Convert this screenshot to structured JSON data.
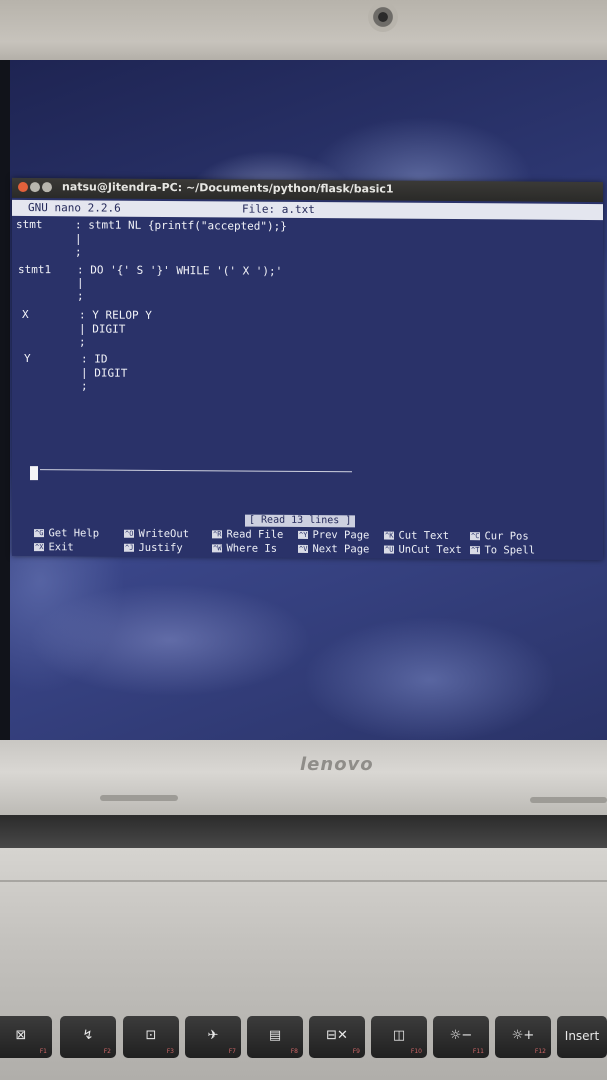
{
  "brand": "lenovo",
  "window": {
    "title": "natsu@Jitendra-PC: ~/Documents/python/flask/basic1"
  },
  "nano": {
    "version": "GNU nano 2.2.6",
    "file": "File: a.txt",
    "status": "[ Read 13 lines ]",
    "lines": [
      {
        "label": "stmt",
        "code": ": stmt1 NL {printf(\"accepted\");}"
      },
      {
        "label": "",
        "code": "|"
      },
      {
        "label": "",
        "code": ";"
      },
      {
        "label": "stmt1",
        "code": ": DO '{' S '}' WHILE '(' X ');'"
      },
      {
        "label": "",
        "code": "|"
      },
      {
        "label": "",
        "code": ";"
      },
      {
        "label": "X",
        "code": ": Y RELOP Y"
      },
      {
        "label": "",
        "code": "| DIGIT"
      },
      {
        "label": "",
        "code": ";"
      },
      {
        "label": "Y",
        "code": ": ID"
      },
      {
        "label": "",
        "code": "| DIGIT"
      },
      {
        "label": "",
        "code": ";"
      }
    ],
    "shortcuts_row1": [
      {
        "key": "^G",
        "label": "Get Help"
      },
      {
        "key": "^O",
        "label": "WriteOut"
      },
      {
        "key": "^R",
        "label": "Read File"
      },
      {
        "key": "^Y",
        "label": "Prev Page"
      },
      {
        "key": "^K",
        "label": "Cut Text"
      },
      {
        "key": "^C",
        "label": "Cur Pos"
      }
    ],
    "shortcuts_row2": [
      {
        "key": "^X",
        "label": "Exit"
      },
      {
        "key": "^J",
        "label": "Justify"
      },
      {
        "key": "^W",
        "label": "Where Is"
      },
      {
        "key": "^V",
        "label": "Next Page"
      },
      {
        "key": "^U",
        "label": "UnCut Text"
      },
      {
        "key": "^T",
        "label": "To Spell"
      }
    ]
  },
  "keyboard": {
    "keys": [
      {
        "glyph": "⊠",
        "fn": "F1"
      },
      {
        "glyph": "↯",
        "fn": "F2"
      },
      {
        "glyph": "⊡",
        "fn": "F3"
      },
      {
        "glyph": "✈",
        "fn": "F7"
      },
      {
        "glyph": "▤",
        "fn": "F8"
      },
      {
        "glyph": "⊟✕",
        "fn": "F9"
      },
      {
        "glyph": "◫",
        "fn": "F10"
      },
      {
        "glyph": "☼−",
        "fn": "F11"
      },
      {
        "glyph": "☼+",
        "fn": "F12"
      },
      {
        "glyph": "Insert",
        "fn": ""
      }
    ]
  }
}
